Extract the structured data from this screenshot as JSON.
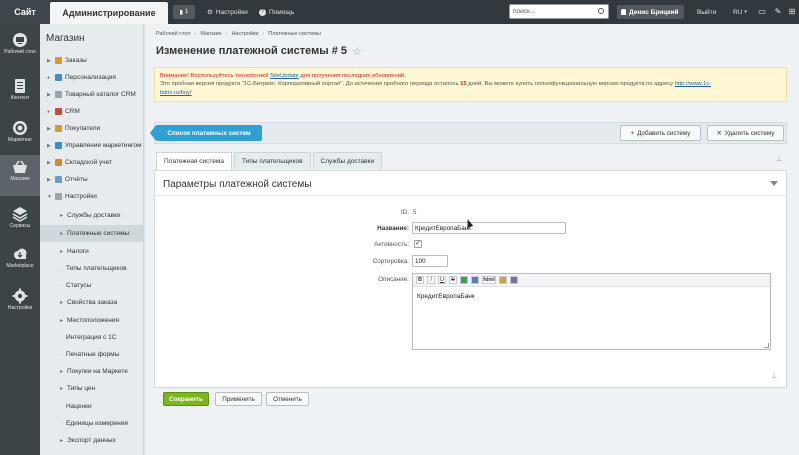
{
  "topbar": {
    "tab_site": "Сайт",
    "tab_admin": "Администрирование",
    "notifications_count": "1",
    "settings": "Настройки",
    "help": "Помощь",
    "search_placeholder": "поиск...",
    "user_name": "Денис Брицкий",
    "logout": "Выйти",
    "lang": "RU"
  },
  "iconbar": [
    {
      "label": "Рабочий стол",
      "icon": "desktop-icon"
    },
    {
      "label": "Контент",
      "icon": "document-icon"
    },
    {
      "label": "Маркетинг",
      "icon": "target-icon"
    },
    {
      "label": "Магазин",
      "icon": "basket-icon"
    },
    {
      "label": "Сервисы",
      "icon": "layers-icon"
    },
    {
      "label": "Marketplace",
      "icon": "cloud-icon"
    },
    {
      "label": "Настройки",
      "icon": "gear-icon"
    }
  ],
  "menu": {
    "title": "Магазин",
    "items": [
      {
        "label": "Заказы"
      },
      {
        "label": "Персонализация"
      },
      {
        "label": "Товарный каталог CRM"
      },
      {
        "label": "CRM"
      },
      {
        "label": "Покупатели"
      },
      {
        "label": "Управление маркетингом"
      },
      {
        "label": "Складской учет"
      },
      {
        "label": "Отчёты"
      },
      {
        "label": "Настройки"
      }
    ],
    "subitems": [
      {
        "label": "Службы доставки"
      },
      {
        "label": "Платежные системы"
      },
      {
        "label": "Налоги"
      },
      {
        "label": "Типы плательщиков"
      },
      {
        "label": "Статусы"
      },
      {
        "label": "Свойства заказа"
      },
      {
        "label": "Местоположения"
      },
      {
        "label": "Интеграция с 1С"
      },
      {
        "label": "Печатные формы"
      },
      {
        "label": "Покупки на Маркете"
      },
      {
        "label": "Типы цен"
      },
      {
        "label": "Наценки"
      },
      {
        "label": "Единицы измерения"
      },
      {
        "label": "Экспорт данных"
      }
    ]
  },
  "breadcrumbs": [
    "Рабочий стол",
    "Магазин",
    "Настройки",
    "Платежные системы"
  ],
  "page_title": "Изменение платежной системы # 5",
  "warning": {
    "line1_prefix": "Внимание! Воспользуйтесь технологией",
    "line1_link": "SiteUpdate",
    "line1_suffix": "для получения последних обновлений.",
    "line2_prefix": "Это пробная версия продукта \"1С-Битрикс: Корпоративный портал\". До истечения пробного периода осталось",
    "line2_days": "15",
    "line2_mid": "дней. Вы можете купить полнофункциональную версию продукта по адресу",
    "line2_link_a": "http://www.1c-",
    "line2_link_b": "bitrix.ru/buy/"
  },
  "toolbar": {
    "list_button": "Список платежных систем",
    "add_button": "Добавить систему",
    "delete_button": "Удалить систему"
  },
  "tabs": [
    "Платежная система",
    "Типы плательщиков",
    "Службы доставки"
  ],
  "form": {
    "section_title": "Параметры платежной системы",
    "id_label": "ID:",
    "id_value": "5",
    "name_label": "Название:",
    "name_value": "КредитЕвропаБанк",
    "active_label": "Активность:",
    "sort_label": "Сортировка:",
    "sort_value": "100",
    "desc_label": "Описание:",
    "desc_value": "КредитЕвропаБанк",
    "editor_buttons": [
      "B",
      "I",
      "U",
      "S",
      "html"
    ]
  },
  "footer": {
    "save": "Сохранить",
    "apply": "Применить",
    "cancel": "Отменить"
  },
  "colors": {
    "topbar": "#32393e",
    "accent_blue": "#2fa0d2",
    "save_green": "#7db51f",
    "warning_red": "#d0221c"
  }
}
